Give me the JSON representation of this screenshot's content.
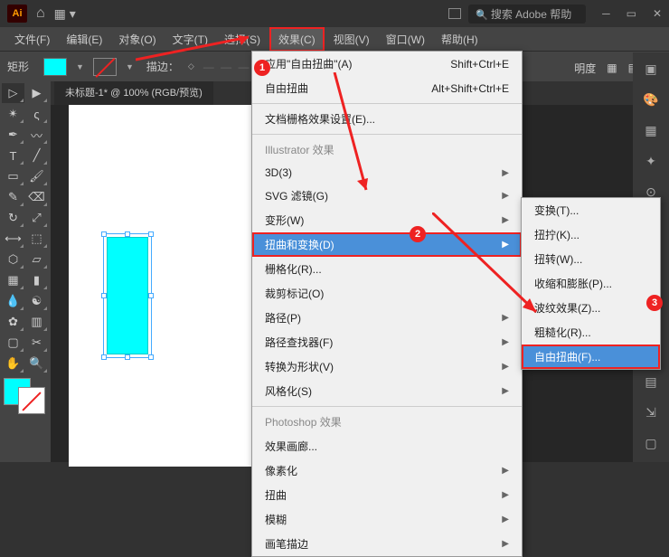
{
  "titlebar": {
    "logo": "Ai",
    "search_placeholder": "搜索 Adobe 帮助"
  },
  "menubar": {
    "file": "文件(F)",
    "edit": "编辑(E)",
    "object": "对象(O)",
    "type": "文字(T)",
    "select": "选择(S)",
    "effect": "效果(C)",
    "view": "视图(V)",
    "window": "窗口(W)",
    "help": "帮助(H)"
  },
  "controlbar": {
    "shape": "矩形",
    "stroke_label": "描边："
  },
  "right_top": {
    "opacity_label": "明度"
  },
  "document": {
    "tab": "未标题-1* @ 100% (RGB/预览)"
  },
  "effect_menu": {
    "apply_last": "应用\"自由扭曲\"(A)",
    "apply_last_shortcut": "Shift+Ctrl+E",
    "free_distort": "自由扭曲",
    "free_distort_shortcut": "Alt+Shift+Ctrl+E",
    "doc_raster": "文档栅格效果设置(E)...",
    "header_ai": "Illustrator 效果",
    "threed": "3D(3)",
    "svg_filters": "SVG 滤镜(G)",
    "warp": "变形(W)",
    "distort_transform": "扭曲和变换(D)",
    "rasterize": "栅格化(R)...",
    "crop_marks": "裁剪标记(O)",
    "path": "路径(P)",
    "pathfinder": "路径查找器(F)",
    "convert_shape": "转换为形状(V)",
    "stylize": "风格化(S)",
    "header_ps": "Photoshop 效果",
    "effect_gallery": "效果画廊...",
    "pixelate": "像素化",
    "distort": "扭曲",
    "blur": "模糊",
    "brush_strokes": "画笔描边"
  },
  "distort_submenu": {
    "transform": "变换(T)...",
    "tweak": "扭拧(K)...",
    "twist": "扭转(W)...",
    "pucker_bloat": "收缩和膨胀(P)...",
    "zigzag": "波纹效果(Z)...",
    "roughen": "粗糙化(R)...",
    "free_distort": "自由扭曲(F)..."
  },
  "badges": {
    "b1": "1",
    "b2": "2",
    "b3": "3"
  }
}
